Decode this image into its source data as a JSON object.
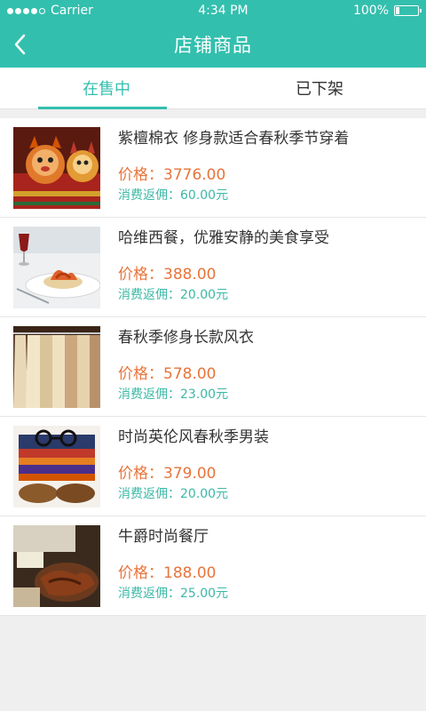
{
  "status": {
    "carrier": "Carrier",
    "time": "4:34 PM",
    "battery": "100%"
  },
  "nav": {
    "title": "店铺商品"
  },
  "tabs": [
    {
      "label": "在售中"
    },
    {
      "label": "已下架"
    }
  ],
  "items": [
    {
      "name": "紫檀棉衣 修身款适合春秋季节穿着",
      "price_label": "价格：",
      "price": "3776.00",
      "rebate_label": "消费返佣：",
      "rebate": "60.00元"
    },
    {
      "name": "哈维西餐，优雅安静的美食享受",
      "price_label": "价格：",
      "price": "388.00",
      "rebate_label": "消费返佣：",
      "rebate": "20.00元"
    },
    {
      "name": "春秋季修身长款风衣",
      "price_label": "价格：",
      "price": "578.00",
      "rebate_label": "消费返佣：",
      "rebate": "23.00元"
    },
    {
      "name": "时尚英伦风春秋季男装",
      "price_label": "价格：",
      "price": "379.00",
      "rebate_label": "消费返佣：",
      "rebate": "20.00元"
    },
    {
      "name": "牛爵时尚餐厅",
      "price_label": "价格：",
      "price": "188.00",
      "rebate_label": "消费返佣：",
      "rebate": "25.00元"
    }
  ],
  "colors": {
    "accent": "#33bfae",
    "price": "#e8743b",
    "rebate": "#3cb8a6"
  },
  "icons": [
    "back-arrow-icon"
  ]
}
